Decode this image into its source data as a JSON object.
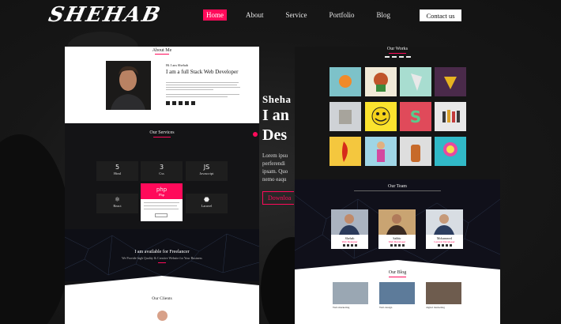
{
  "brand": {
    "logo": "SHEHAB"
  },
  "nav": {
    "items": [
      {
        "label": "Home",
        "active": true
      },
      {
        "label": "About"
      },
      {
        "label": "Service"
      },
      {
        "label": "Portfolio"
      },
      {
        "label": "Blog"
      }
    ],
    "contact": "Contact us"
  },
  "colors": {
    "accent": "#ff0a5a",
    "page_bg": "#161616"
  },
  "about": {
    "title": "About Me",
    "name": "Hi I am Shehab",
    "role": "I am a full Stack Web Developer"
  },
  "services": {
    "title": "Our Services",
    "items": [
      {
        "label": "Html",
        "icon": "html5-icon",
        "glyph": "5"
      },
      {
        "label": "Css",
        "icon": "css3-icon",
        "glyph": "3"
      },
      {
        "label": "Javascript",
        "icon": "js-icon",
        "glyph": "JS"
      },
      {
        "label": "Php",
        "icon": "php-icon",
        "glyph": "php"
      },
      {
        "label": "React",
        "icon": "react-icon",
        "glyph": "⚛"
      },
      {
        "label": "Laravel",
        "icon": "laravel-icon",
        "glyph": "⬣"
      }
    ]
  },
  "freelance": {
    "title": "I am available for Freelancer",
    "subtitle": "We Provide high Quality & Creative Website for Your Business"
  },
  "clients": {
    "title": "Our Clients"
  },
  "hero": {
    "greeting": "Sheha",
    "line1": "I an",
    "line2": "Des",
    "body": [
      "Lorem ipsu",
      "perferendi",
      "ipsam. Quo",
      "nemo eaqu"
    ],
    "download": "Downloa"
  },
  "works": {
    "title": "Our Works"
  },
  "team": {
    "title": "Our Team",
    "members": [
      {
        "name": "Shehab",
        "role": "Web Designer"
      },
      {
        "name": "Sabbir",
        "role": "Web Developer"
      },
      {
        "name": "Mohammed",
        "role": "Laravel Developer"
      }
    ]
  },
  "blog": {
    "title": "Our Blog",
    "posts": [
      "Web marketing",
      "Web design",
      "digital marketing"
    ]
  }
}
